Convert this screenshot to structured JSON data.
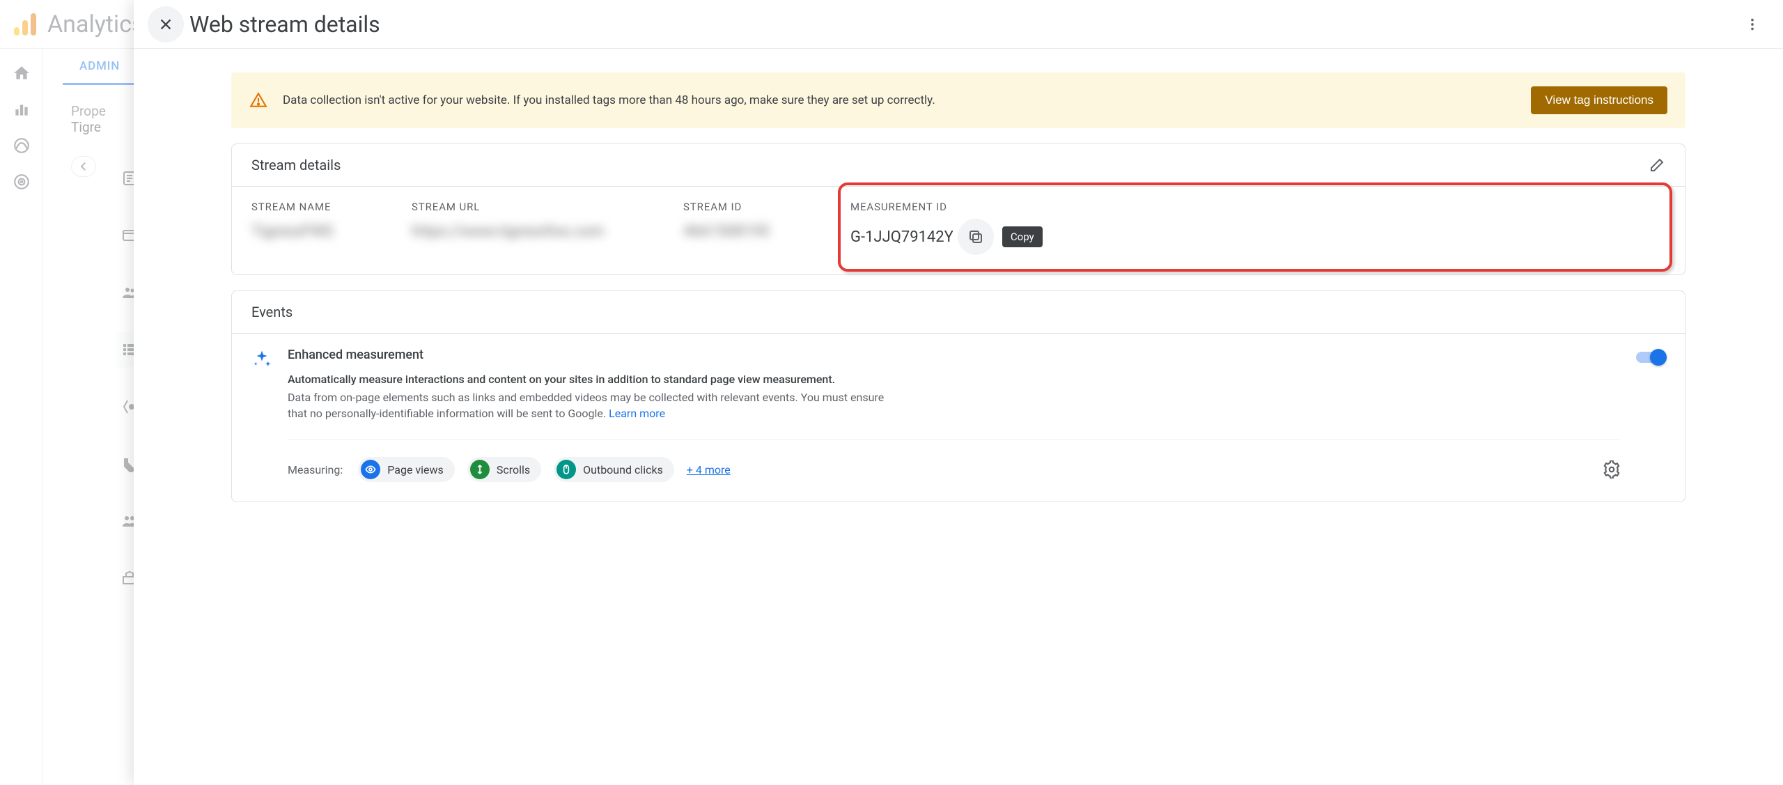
{
  "app": {
    "title": "Analytics",
    "admin_tab": "ADMIN",
    "property_label": "Prope",
    "property_name": "Tigre"
  },
  "panel": {
    "title": "Web stream details"
  },
  "banner": {
    "text": "Data collection isn't active for your website. If you installed tags more than 48 hours ago, make sure they are set up correctly.",
    "button": "View tag instructions"
  },
  "stream_card": {
    "title": "Stream details",
    "columns": {
      "name_label": "STREAM NAME",
      "name_value": "TigressFWS",
      "url_label": "STREAM URL",
      "url_value": "https://www.tigressfws.com",
      "id_label": "STREAM ID",
      "id_value": "4661508195",
      "meas_label": "MEASUREMENT ID",
      "meas_value": "G-1JJQ79142Y"
    },
    "copy_tooltip": "Copy"
  },
  "events_card": {
    "title": "Events",
    "em_title": "Enhanced measurement",
    "em_bold": "Automatically measure interactions and content on your sites in addition to standard page view measurement.",
    "em_desc": "Data from on-page elements such as links and embedded videos may be collected with relevant events. You must ensure that no personally-identifiable information will be sent to Google. ",
    "learn_more": "Learn more",
    "measuring_label": "Measuring:",
    "chips": {
      "page_views": "Page views",
      "scrolls": "Scrolls",
      "outbound": "Outbound clicks"
    },
    "more": "+ 4 more"
  }
}
